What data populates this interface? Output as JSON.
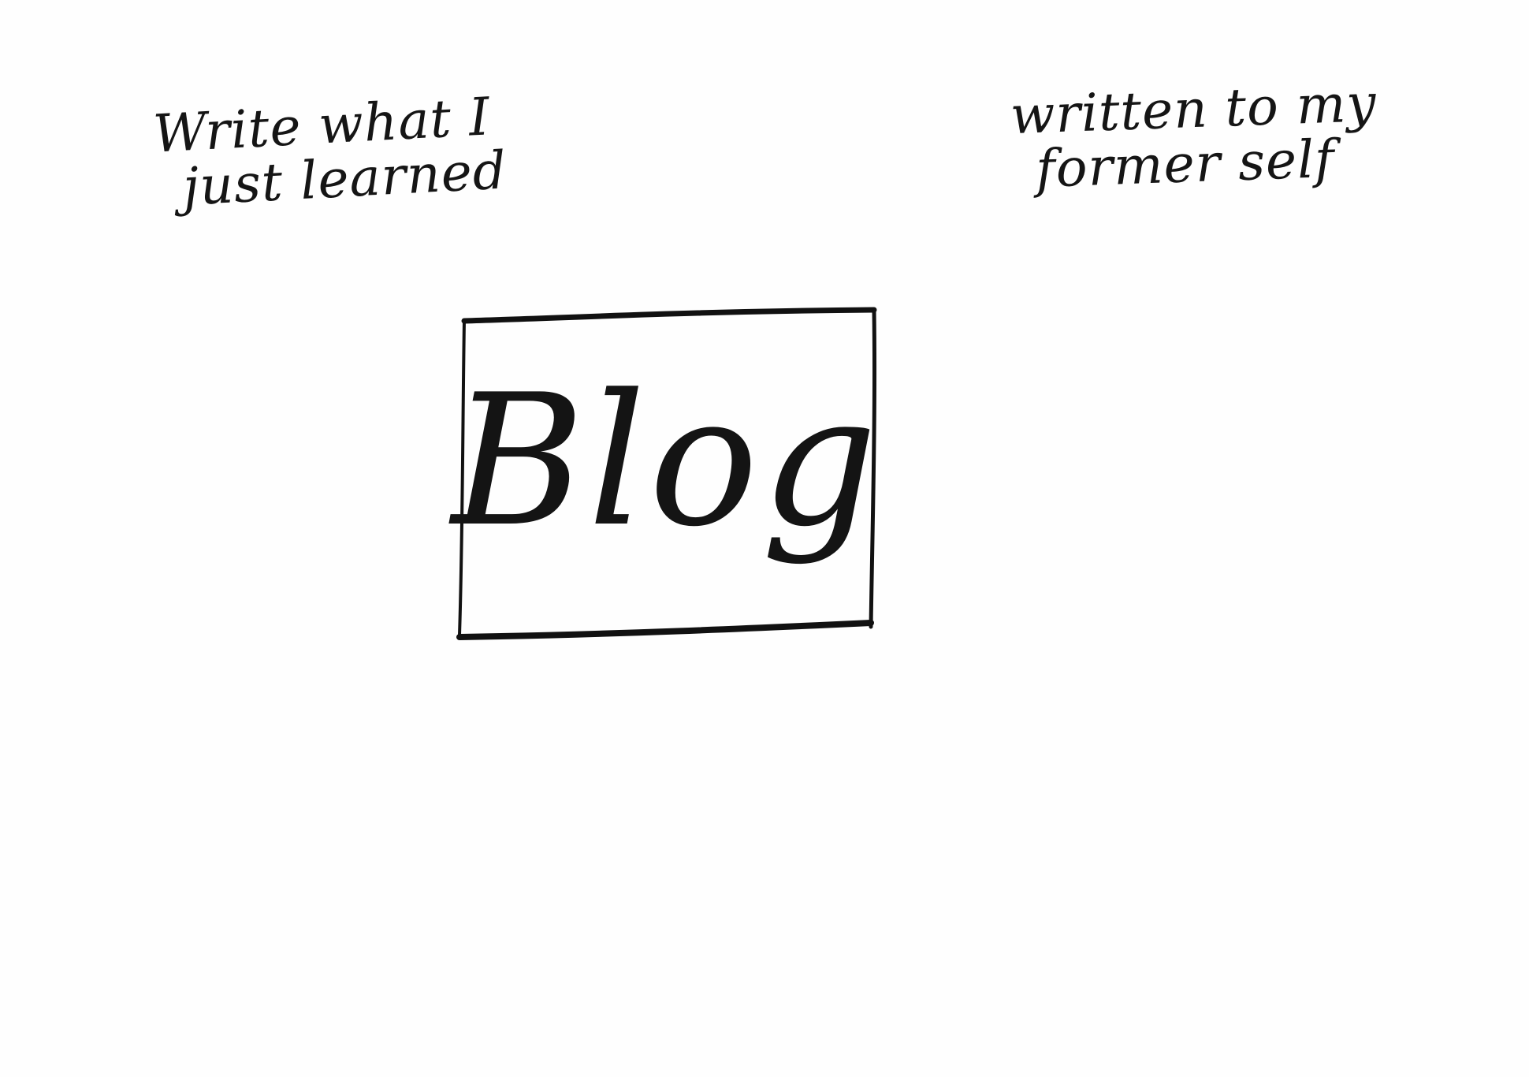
{
  "notes": {
    "left": {
      "line1": "Write what I",
      "line2": "just learned"
    },
    "right": {
      "line1": "written to my",
      "line2": "former self"
    }
  },
  "center": {
    "label": "Blog"
  },
  "colors": {
    "ink": "#111111",
    "paper": "#fefefe"
  }
}
